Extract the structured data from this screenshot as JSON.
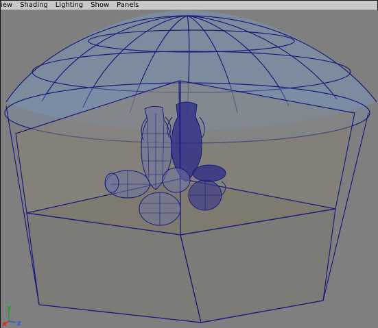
{
  "menubar": {
    "items": [
      {
        "id": "view",
        "label": "iew"
      },
      {
        "id": "shading",
        "label": "Shading"
      },
      {
        "id": "lighting",
        "label": "Lighting"
      },
      {
        "id": "show",
        "label": "Show"
      },
      {
        "id": "panels",
        "label": "Panels"
      }
    ]
  },
  "viewport": {
    "axis": {
      "x_label": "x",
      "y_label": "y",
      "z_label": "z",
      "x_color": "#e02020",
      "y_color": "#20a020",
      "z_color": "#2060e0"
    },
    "colors": {
      "background": "#7f7f7f",
      "wireframe": "#1a1a7a",
      "dome_fill": "#7a93b3",
      "wall_fill": "#8a8275",
      "floor_fill": "#7c766c"
    }
  }
}
